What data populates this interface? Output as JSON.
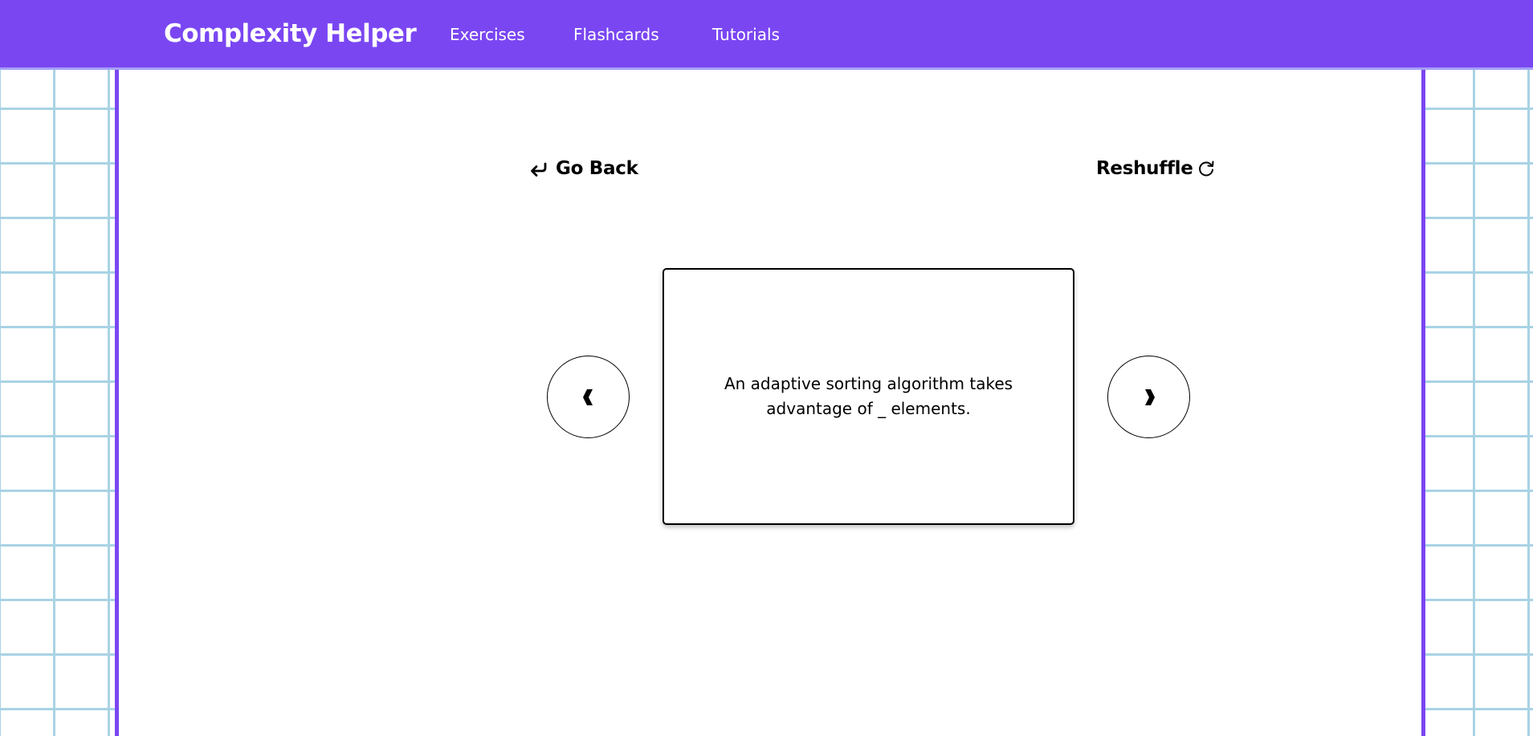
{
  "header": {
    "brand": "Complexity Helper",
    "nav": [
      {
        "label": "Exercises"
      },
      {
        "label": "Flashcards"
      },
      {
        "label": "Tutorials"
      }
    ]
  },
  "controls": {
    "go_back_label": "Go Back",
    "go_back_icon": "return-arrow-icon",
    "reshuffle_label": "Reshuffle",
    "reshuffle_icon": "refresh-icon",
    "prev_icon": "chevron-left-icon",
    "next_icon": "chevron-right-icon"
  },
  "flashcard": {
    "text": "An adaptive sorting algorithm takes advantage of _ elements."
  },
  "colors": {
    "accent": "#7a46f2",
    "grid_line": "#a9d3e4",
    "text": "#000000",
    "card_background": "#ffffff"
  }
}
